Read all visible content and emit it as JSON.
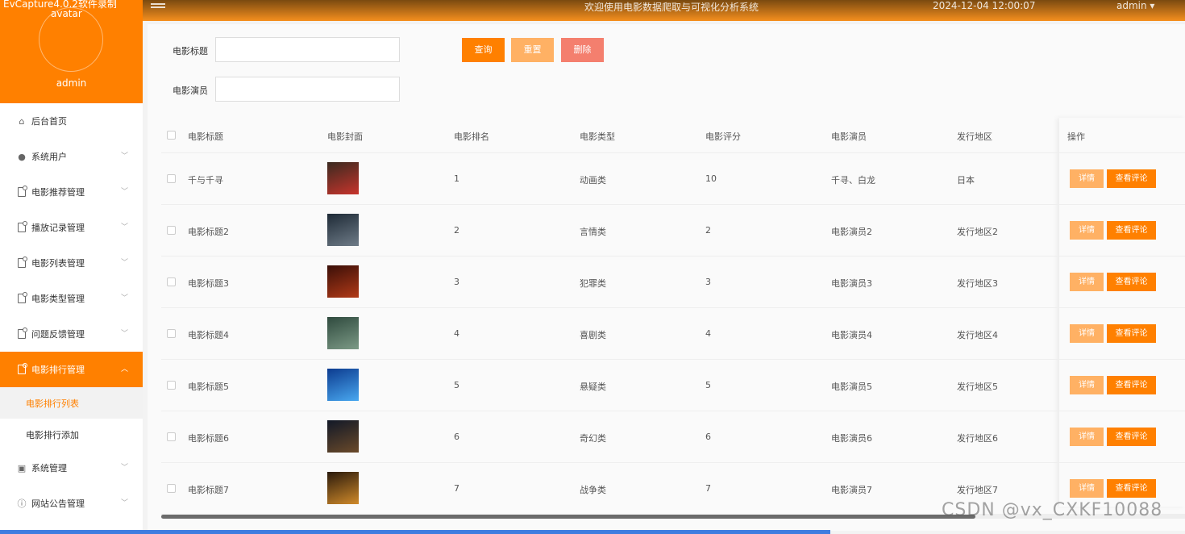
{
  "capture_label": "EvCapture4.0.2软件录制",
  "header": {
    "title": "欢迎使用电影数据爬取与可视化分析系统",
    "datetime": "2024-12-04 12:00:07",
    "user": "admin ▾"
  },
  "sidebar": {
    "avatar_alt": "avatar",
    "username": "admin",
    "items": [
      {
        "label": "后台首页",
        "icon": "home-icon"
      },
      {
        "label": "系统用户",
        "icon": "user-icon"
      },
      {
        "label": "电影推荐管理",
        "icon": "file-icon"
      },
      {
        "label": "播放记录管理",
        "icon": "file-icon"
      },
      {
        "label": "电影列表管理",
        "icon": "file-icon"
      },
      {
        "label": "电影类型管理",
        "icon": "file-icon"
      },
      {
        "label": "问题反馈管理",
        "icon": "file-icon"
      },
      {
        "label": "电影排行管理",
        "icon": "file-icon"
      },
      {
        "label": "系统管理",
        "icon": "image-icon"
      },
      {
        "label": "网站公告管理",
        "icon": "info-icon"
      }
    ],
    "sub_items": [
      {
        "label": "电影排行列表"
      },
      {
        "label": "电影排行添加"
      }
    ]
  },
  "search": {
    "title_label": "电影标题",
    "actor_label": "电影演员",
    "title_value": "",
    "actor_value": "",
    "query_button": "查询",
    "reset_button": "重置",
    "delete_button": "删除"
  },
  "colors": {
    "primary": "#ff8000",
    "reset": "#ffb164",
    "delete": "#f47f6e",
    "detail": "#ffb164"
  },
  "table": {
    "columns": [
      "电影标题",
      "电影封面",
      "电影排名",
      "电影类型",
      "电影评分",
      "电影演员",
      "发行地区",
      "操作"
    ],
    "detail_label": "详情",
    "comments_label": "查看评论",
    "rows": [
      {
        "title": "千与千寻",
        "rank": "1",
        "type": "动画类",
        "score": "10",
        "actor": "千寻、白龙",
        "region": "日本",
        "cover_colors": [
          "#3a2a20",
          "#c8342c"
        ]
      },
      {
        "title": "电影标题2",
        "rank": "2",
        "type": "言情类",
        "score": "2",
        "actor": "电影演员2",
        "region": "发行地区2",
        "cover_colors": [
          "#1e2a36",
          "#6f7c88"
        ]
      },
      {
        "title": "电影标题3",
        "rank": "3",
        "type": "犯罪类",
        "score": "3",
        "actor": "电影演员3",
        "region": "发行地区3",
        "cover_colors": [
          "#3a0f08",
          "#b23a18"
        ]
      },
      {
        "title": "电影标题4",
        "rank": "4",
        "type": "喜剧类",
        "score": "4",
        "actor": "电影演员4",
        "region": "发行地区4",
        "cover_colors": [
          "#2f4a3e",
          "#7c9a86"
        ]
      },
      {
        "title": "电影标题5",
        "rank": "5",
        "type": "悬疑类",
        "score": "5",
        "actor": "电影演员5",
        "region": "发行地区5",
        "cover_colors": [
          "#0c3b8f",
          "#49a8f0"
        ]
      },
      {
        "title": "电影标题6",
        "rank": "6",
        "type": "奇幻类",
        "score": "6",
        "actor": "电影演员6",
        "region": "发行地区6",
        "cover_colors": [
          "#111827",
          "#6b4a2a"
        ]
      },
      {
        "title": "电影标题7",
        "rank": "7",
        "type": "战争类",
        "score": "7",
        "actor": "电影演员7",
        "region": "发行地区7",
        "cover_colors": [
          "#2a1a0c",
          "#d08a2a"
        ]
      }
    ]
  },
  "watermark": "CSDN @vx_CXKF10088"
}
